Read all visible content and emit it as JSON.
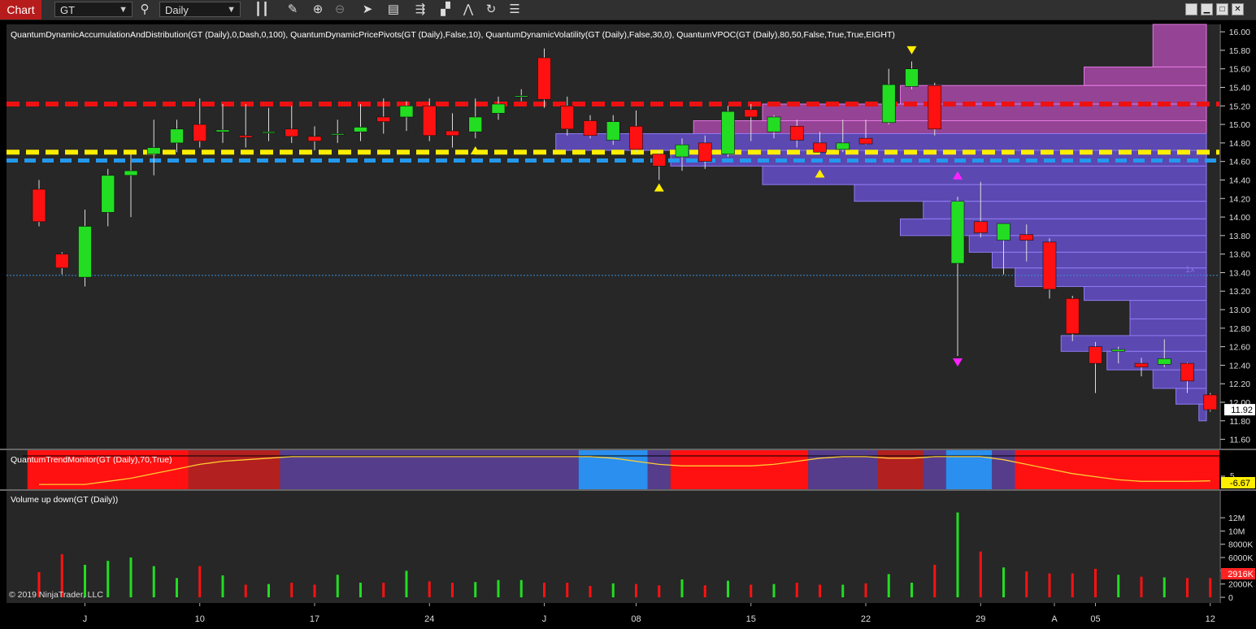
{
  "toolbar": {
    "chart_tab": "Chart",
    "instrument": "GT",
    "period": "Daily"
  },
  "price_panel": {
    "indicators_label": "QuantumDynamicAccumulationAndDistribution(GT (Daily),0,Dash,0,100), QuantumDynamicPricePivots(GT (Daily),False,10), QuantumDynamicVolatility(GT (Daily),False,30,0), QuantumVPOC(GT (Daily),80,50,False,True,True,EIGHT)",
    "y_ticks": [
      "16.00",
      "15.80",
      "15.60",
      "15.40",
      "15.20",
      "15.00",
      "14.80",
      "14.60",
      "14.40",
      "14.20",
      "14.00",
      "13.80",
      "13.60",
      "13.40",
      "13.20",
      "13.00",
      "12.80",
      "12.60",
      "12.40",
      "12.20",
      "12.00",
      "11.80",
      "11.60"
    ],
    "last_price": "11.92",
    "poc_marker": "1x"
  },
  "trend_panel": {
    "label": "QuantumTrendMonitor(GT (Daily),70,True)",
    "tick": "5",
    "last_value": "-6.67"
  },
  "volume_panel": {
    "label": "Volume up down(GT (Daily))",
    "y_ticks": [
      "12M",
      "10M",
      "8000K",
      "6000K",
      "4000K",
      "2000K",
      "0"
    ],
    "last_value": "2916K",
    "copyright": "© 2019 NinjaTrader, LLC"
  },
  "x_axis": {
    "labels": [
      "J",
      "10",
      "17",
      "24",
      "J",
      "08",
      "15",
      "22",
      "29",
      "A",
      "05",
      "12"
    ]
  },
  "colors": {
    "up": "#22dd22",
    "down": "#ff1111",
    "resistance": "#ee1111",
    "pivot": "#ffee00",
    "support": "#2299ee"
  },
  "chart_data": {
    "type": "candlestick",
    "candles": [
      {
        "o": 14.3,
        "h": 14.4,
        "l": 13.9,
        "c": 13.95
      },
      {
        "o": 13.6,
        "h": 13.62,
        "l": 13.38,
        "c": 13.45
      },
      {
        "o": 13.35,
        "h": 14.08,
        "l": 13.25,
        "c": 13.9
      },
      {
        "o": 14.05,
        "h": 14.52,
        "l": 13.9,
        "c": 14.45
      },
      {
        "o": 14.45,
        "h": 14.68,
        "l": 14.0,
        "c": 14.5
      },
      {
        "o": 14.68,
        "h": 15.05,
        "l": 14.45,
        "c": 14.75
      },
      {
        "o": 14.8,
        "h": 15.05,
        "l": 14.7,
        "c": 14.95
      },
      {
        "o": 15.0,
        "h": 15.28,
        "l": 14.75,
        "c": 14.82
      },
      {
        "o": 14.92,
        "h": 15.22,
        "l": 14.8,
        "c": 14.94
      },
      {
        "o": 14.88,
        "h": 15.22,
        "l": 14.75,
        "c": 14.86
      },
      {
        "o": 14.92,
        "h": 15.18,
        "l": 14.82,
        "c": 14.92
      },
      {
        "o": 14.95,
        "h": 15.2,
        "l": 14.8,
        "c": 14.87
      },
      {
        "o": 14.87,
        "h": 14.98,
        "l": 14.72,
        "c": 14.82
      },
      {
        "o": 14.9,
        "h": 15.05,
        "l": 14.8,
        "c": 14.9
      },
      {
        "o": 14.92,
        "h": 15.22,
        "l": 14.82,
        "c": 14.97
      },
      {
        "o": 15.08,
        "h": 15.28,
        "l": 14.9,
        "c": 15.03
      },
      {
        "o": 15.08,
        "h": 15.25,
        "l": 14.93,
        "c": 15.2
      },
      {
        "o": 15.2,
        "h": 15.28,
        "l": 14.82,
        "c": 14.88
      },
      {
        "o": 14.93,
        "h": 15.12,
        "l": 14.75,
        "c": 14.88
      },
      {
        "o": 14.92,
        "h": 15.28,
        "l": 14.85,
        "c": 15.08
      },
      {
        "o": 15.12,
        "h": 15.3,
        "l": 15.05,
        "c": 15.22
      },
      {
        "o": 15.3,
        "h": 15.38,
        "l": 15.25,
        "c": 15.31
      },
      {
        "o": 15.72,
        "h": 15.82,
        "l": 15.18,
        "c": 15.27
      },
      {
        "o": 15.2,
        "h": 15.3,
        "l": 14.88,
        "c": 14.95
      },
      {
        "o": 15.04,
        "h": 15.1,
        "l": 14.85,
        "c": 14.88
      },
      {
        "o": 14.83,
        "h": 15.1,
        "l": 14.78,
        "c": 15.03
      },
      {
        "o": 14.98,
        "h": 15.15,
        "l": 14.7,
        "c": 14.73
      },
      {
        "o": 14.68,
        "h": 14.72,
        "l": 14.4,
        "c": 14.55
      },
      {
        "o": 14.65,
        "h": 14.85,
        "l": 14.5,
        "c": 14.78
      },
      {
        "o": 14.8,
        "h": 14.88,
        "l": 14.52,
        "c": 14.6
      },
      {
        "o": 14.68,
        "h": 15.2,
        "l": 14.65,
        "c": 15.14
      },
      {
        "o": 15.16,
        "h": 15.22,
        "l": 14.82,
        "c": 15.08
      },
      {
        "o": 14.92,
        "h": 15.1,
        "l": 14.85,
        "c": 15.08
      },
      {
        "o": 14.98,
        "h": 15.05,
        "l": 14.75,
        "c": 14.83
      },
      {
        "o": 14.8,
        "h": 14.92,
        "l": 14.68,
        "c": 14.7
      },
      {
        "o": 14.73,
        "h": 15.05,
        "l": 14.7,
        "c": 14.8
      },
      {
        "o": 14.85,
        "h": 15.05,
        "l": 14.78,
        "c": 14.79
      },
      {
        "o": 15.02,
        "h": 15.6,
        "l": 15.0,
        "c": 15.43
      },
      {
        "o": 15.41,
        "h": 15.68,
        "l": 15.38,
        "c": 15.6
      },
      {
        "o": 15.42,
        "h": 15.45,
        "l": 14.88,
        "c": 14.95
      },
      {
        "o": 13.5,
        "h": 14.22,
        "l": 12.5,
        "c": 14.17
      },
      {
        "o": 13.95,
        "h": 14.38,
        "l": 13.78,
        "c": 13.83
      },
      {
        "o": 13.75,
        "h": 13.92,
        "l": 13.38,
        "c": 13.93
      },
      {
        "o": 13.81,
        "h": 13.92,
        "l": 13.52,
        "c": 13.75
      },
      {
        "o": 13.73,
        "h": 13.77,
        "l": 13.12,
        "c": 13.22
      },
      {
        "o": 13.12,
        "h": 13.15,
        "l": 12.66,
        "c": 12.74
      },
      {
        "o": 12.6,
        "h": 12.65,
        "l": 12.1,
        "c": 12.42
      },
      {
        "o": 12.55,
        "h": 12.6,
        "l": 12.42,
        "c": 12.57
      },
      {
        "o": 12.42,
        "h": 12.48,
        "l": 12.28,
        "c": 12.38
      },
      {
        "o": 12.41,
        "h": 12.68,
        "l": 12.38,
        "c": 12.47
      },
      {
        "o": 12.42,
        "h": 12.43,
        "l": 12.1,
        "c": 12.23
      },
      {
        "o": 12.08,
        "h": 12.1,
        "l": 11.9,
        "c": 11.92
      }
    ],
    "volume": [
      3800,
      6500,
      4900,
      5500,
      6000,
      4700,
      2900,
      4700,
      3300,
      1900,
      2000,
      2200,
      1900,
      3400,
      2200,
      2200,
      4000,
      2400,
      2200,
      2300,
      2600,
      2600,
      2200,
      2200,
      1700,
      2100,
      2000,
      1800,
      2700,
      1800,
      2500,
      1900,
      2000,
      2200,
      1900,
      1900,
      2100,
      3500,
      2200,
      4900,
      12800,
      6900,
      4500,
      3900,
      3600,
      3600,
      4300,
      3400,
      3100,
      3000,
      2900,
      2900
    ],
    "ylim": [
      11.5,
      16.08
    ],
    "levels": {
      "resistance": 15.22,
      "pivot": 14.7,
      "support": 14.61,
      "last": 11.92,
      "poc": 13.37
    },
    "vpoc_upper": [
      {
        "lo": 15.62,
        "hi": 16.08,
        "from": 49
      },
      {
        "lo": 15.42,
        "hi": 15.62,
        "from": 46
      },
      {
        "lo": 15.22,
        "hi": 15.42,
        "from": 38
      },
      {
        "lo": 15.04,
        "hi": 15.22,
        "from": 32
      },
      {
        "lo": 14.9,
        "hi": 15.04,
        "from": 29
      }
    ],
    "vpoc_lower": [
      {
        "lo": 14.72,
        "hi": 14.9,
        "from": 23
      },
      {
        "lo": 14.55,
        "hi": 14.72,
        "from": 28
      },
      {
        "lo": 14.35,
        "hi": 14.55,
        "from": 32
      },
      {
        "lo": 14.17,
        "hi": 14.35,
        "from": 36
      },
      {
        "lo": 13.98,
        "hi": 14.17,
        "from": 39
      },
      {
        "lo": 13.8,
        "hi": 13.98,
        "from": 38
      },
      {
        "lo": 13.62,
        "hi": 13.8,
        "from": 41
      },
      {
        "lo": 13.45,
        "hi": 13.62,
        "from": 42
      },
      {
        "lo": 13.25,
        "hi": 13.45,
        "from": 43
      },
      {
        "lo": 13.1,
        "hi": 13.25,
        "from": 46
      },
      {
        "lo": 12.9,
        "hi": 13.1,
        "from": 48
      },
      {
        "lo": 12.72,
        "hi": 12.9,
        "from": 48
      },
      {
        "lo": 12.55,
        "hi": 12.72,
        "from": 45
      },
      {
        "lo": 12.35,
        "hi": 12.55,
        "from": 47
      },
      {
        "lo": 12.15,
        "hi": 12.35,
        "from": 49
      },
      {
        "lo": 11.98,
        "hi": 12.15,
        "from": 50
      },
      {
        "lo": 11.8,
        "hi": 11.98,
        "from": 51
      },
      {
        "lo": 11.62,
        "hi": 11.8,
        "from": 51.5
      }
    ],
    "arrows": [
      {
        "bar": 27,
        "price": 14.32,
        "dir": "up",
        "color": "#ffee00"
      },
      {
        "bar": 34,
        "price": 14.47,
        "dir": "up",
        "color": "#ffee00"
      },
      {
        "bar": 38,
        "price": 15.8,
        "dir": "down",
        "color": "#ffee00"
      },
      {
        "bar": 40,
        "price": 14.45,
        "dir": "up",
        "color": "#ff22ff"
      },
      {
        "bar": 40,
        "price": 12.43,
        "dir": "down",
        "color": "#ff22ff"
      },
      {
        "bar": 19,
        "price": 14.72,
        "dir": "up",
        "color": "#ffee00"
      }
    ],
    "trend_segments": [
      {
        "from": -1,
        "to": 6,
        "color": "#ff1111"
      },
      {
        "from": 6,
        "to": 10,
        "color": "#b22020"
      },
      {
        "from": 10,
        "to": 23,
        "color": "#553d8c"
      },
      {
        "from": 23,
        "to": 26,
        "color": "#2a8fee"
      },
      {
        "from": 26,
        "to": 27,
        "color": "#553d8c"
      },
      {
        "from": 27,
        "to": 33,
        "color": "#ff1111"
      },
      {
        "from": 33,
        "to": 36,
        "color": "#553d8c"
      },
      {
        "from": 36,
        "to": 38,
        "color": "#b22020"
      },
      {
        "from": 38,
        "to": 39,
        "color": "#553d8c"
      },
      {
        "from": 39,
        "to": 41,
        "color": "#2a8fee"
      },
      {
        "from": 41,
        "to": 42,
        "color": "#553d8c"
      },
      {
        "from": 42,
        "to": 52,
        "color": "#ff1111"
      }
    ],
    "trend_line": [
      -9,
      -9,
      -9,
      -7,
      -5,
      -2,
      1,
      4,
      6,
      7,
      8,
      9,
      9,
      9,
      9,
      9,
      9,
      9,
      9,
      9,
      9,
      9,
      9,
      9,
      9,
      8,
      6,
      4,
      3,
      3,
      3,
      3,
      4,
      6,
      8,
      9,
      9,
      8,
      8,
      9,
      9,
      9,
      7,
      4,
      1,
      -2,
      -4,
      -6,
      -7,
      -7,
      -7,
      -6.67
    ],
    "trend_range": [
      -10,
      10
    ]
  }
}
